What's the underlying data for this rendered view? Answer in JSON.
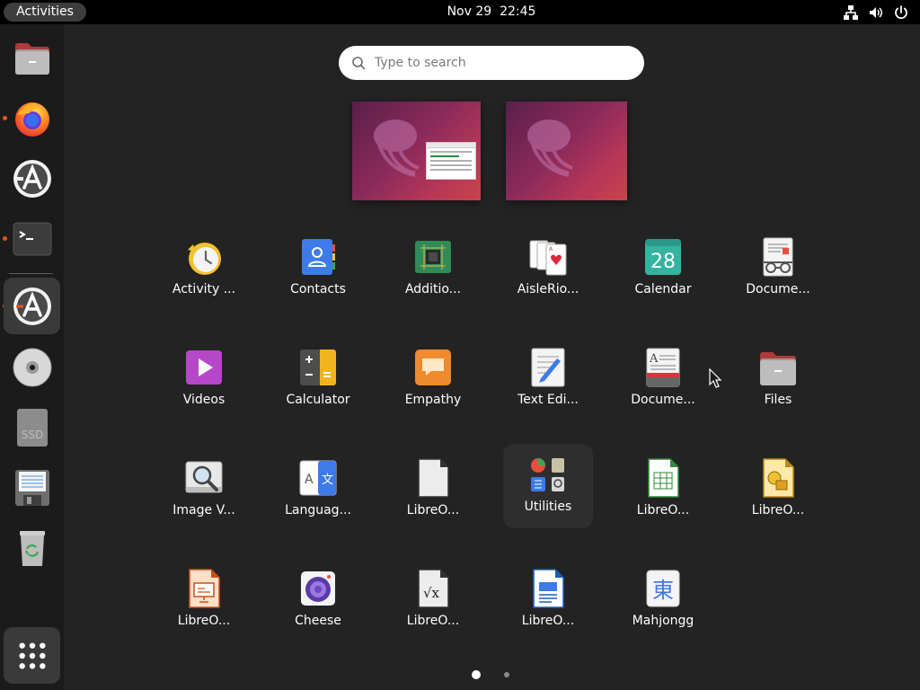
{
  "topbar": {
    "activities_label": "Activities",
    "date": "Nov 29",
    "time": "22:45",
    "tray_icons": [
      "network-icon",
      "volume-icon",
      "power-icon"
    ]
  },
  "dock": {
    "items": [
      {
        "name": "files",
        "icon": "files-icon",
        "running": false
      },
      {
        "name": "firefox",
        "icon": "firefox-icon",
        "running": true
      },
      {
        "name": "software-updater",
        "icon": "software-icon",
        "running": false
      },
      {
        "name": "terminal",
        "icon": "terminal-icon",
        "running": true
      },
      {
        "name": "ubuntu-software",
        "icon": "software-icon",
        "running": true,
        "active": true
      },
      {
        "name": "optical-disc",
        "icon": "disc-icon",
        "running": false
      },
      {
        "name": "ssd-drive",
        "icon": "drive-icon",
        "label": "SSD",
        "running": false
      },
      {
        "name": "floppy",
        "icon": "floppy-icon",
        "running": false
      },
      {
        "name": "trash",
        "icon": "trash-icon",
        "running": false
      }
    ],
    "show_apps_icon": "grid-icon"
  },
  "search": {
    "placeholder": "Type to search",
    "value": ""
  },
  "apps": [
    {
      "label": "Activity ...",
      "icon": "activity-log-icon"
    },
    {
      "label": "Contacts",
      "icon": "contacts-icon"
    },
    {
      "label": "Additio...",
      "icon": "chip-icon"
    },
    {
      "label": "AisleRio...",
      "icon": "cards-icon"
    },
    {
      "label": "Calendar",
      "icon": "calendar-icon",
      "number": "28"
    },
    {
      "label": "Docume...",
      "icon": "document-viewer-icon"
    },
    {
      "label": "Videos",
      "icon": "videos-icon"
    },
    {
      "label": "Calculator",
      "icon": "calculator-icon"
    },
    {
      "label": "Empathy",
      "icon": "chat-icon"
    },
    {
      "label": "Text Edi...",
      "icon": "text-editor-icon"
    },
    {
      "label": "Docume...",
      "icon": "document-scanner-icon"
    },
    {
      "label": "Files",
      "icon": "files-icon"
    },
    {
      "label": "Image V...",
      "icon": "image-viewer-icon"
    },
    {
      "label": "Languag...",
      "icon": "language-icon"
    },
    {
      "label": "LibreO...",
      "icon": "libreoffice-icon"
    },
    {
      "label": "Utilities",
      "icon": "utilities-folder-icon",
      "highlighted": true
    },
    {
      "label": "LibreO...",
      "icon": "libreoffice-calc-icon"
    },
    {
      "label": "LibreO...",
      "icon": "libreoffice-draw-icon"
    },
    {
      "label": "LibreO...",
      "icon": "libreoffice-impress-icon"
    },
    {
      "label": "Cheese",
      "icon": "cheese-icon"
    },
    {
      "label": "LibreO...",
      "icon": "libreoffice-math-icon"
    },
    {
      "label": "LibreO...",
      "icon": "libreoffice-writer-icon"
    },
    {
      "label": "Mahjongg",
      "icon": "mahjongg-icon",
      "glyph": "東"
    }
  ],
  "pages": {
    "count": 2,
    "current": 1
  },
  "colors": {
    "accent": "#e95420",
    "background": "#232323",
    "topbar": "#000000",
    "dock": "#1b1b1b"
  }
}
